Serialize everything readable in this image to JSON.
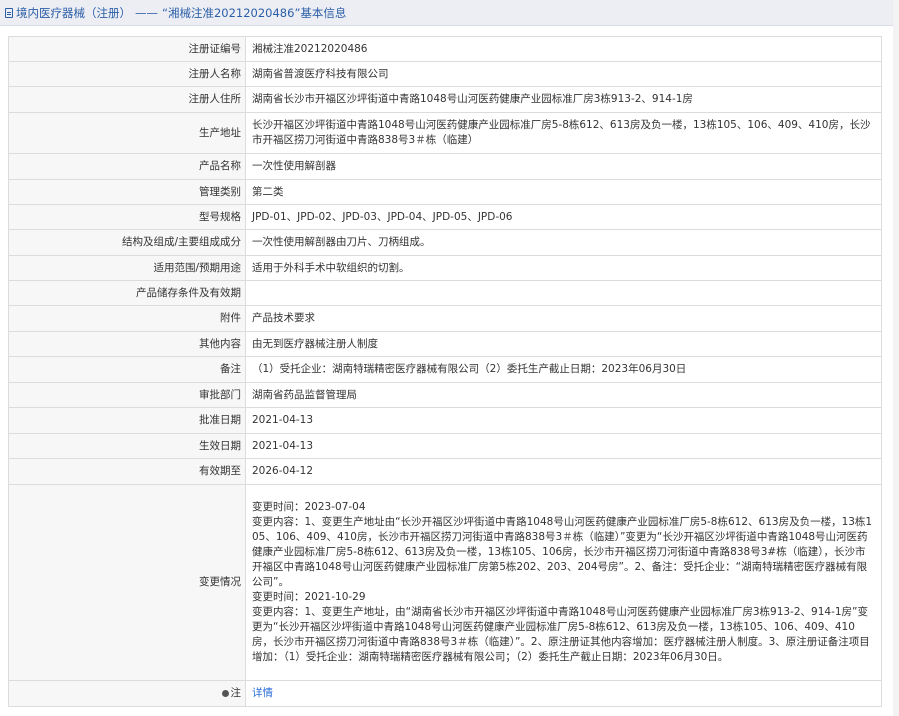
{
  "header": {
    "crumb": "境内医疗器械（注册）",
    "separator": "——",
    "title": "“湘械注准20212020486”基本信息"
  },
  "rows": [
    {
      "label": "注册证编号",
      "value": "湘械注准20212020486"
    },
    {
      "label": "注册人名称",
      "value": "湖南省普渡医疗科技有限公司"
    },
    {
      "label": "注册人住所",
      "value": "湖南省长沙市开福区沙坪街道中青路1048号山河医药健康产业园标准厂房3栋913-2、914-1房"
    },
    {
      "label": "生产地址",
      "value": "长沙开福区沙坪街道中青路1048号山河医药健康产业园标准厂房5-8栋612、613房及负一楼，13栋105、106、409、410房，长沙市开福区捞刀河街道中青路838号3＃栋（临建）"
    },
    {
      "label": "产品名称",
      "value": "一次性使用解剖器"
    },
    {
      "label": "管理类别",
      "value": "第二类"
    },
    {
      "label": "型号规格",
      "value": "JPD-01、JPD-02、JPD-03、JPD-04、JPD-05、JPD-06"
    },
    {
      "label": "结构及组成/主要组成成分",
      "value": "一次性使用解剖器由刀片、刀柄组成。"
    },
    {
      "label": "适用范围/预期用途",
      "value": "适用于外科手术中软组织的切割。"
    },
    {
      "label": "产品储存条件及有效期",
      "value": ""
    },
    {
      "label": "附件",
      "value": "产品技术要求"
    },
    {
      "label": "其他内容",
      "value": "由无到医疗器械注册人制度"
    },
    {
      "label": "备注",
      "value": "（1）受托企业：湖南特瑞精密医疗器械有限公司（2）委托生产截止日期：2023年06月30日"
    },
    {
      "label": "审批部门",
      "value": "湖南省药品监督管理局"
    },
    {
      "label": "批准日期",
      "value": "2021-04-13"
    },
    {
      "label": "生效日期",
      "value": "2021-04-13"
    },
    {
      "label": "有效期至",
      "value": "2026-04-12"
    }
  ],
  "changes": {
    "label": "变更情况",
    "lines": [
      "变更时间：2023-07-04",
      "变更内容：1、变更生产地址由“长沙开福区沙坪街道中青路1048号山河医药健康产业园标准厂房5-8栋612、613房及负一楼，13栋105、106、409、410房，长沙市开福区捞刀河街道中青路838号3＃栋（临建）”变更为“长沙开福区沙坪街道中青路1048号山河医药健康产业园标准厂房5-8栋612、613房及负一楼，13栋105、106房，长沙市开福区捞刀河街道中青路838号3#栋（临建），长沙市开福区中青路1048号山河医药健康产业园标准厂房第5栋202、203、204号房”。2、备注：受托企业：“湖南特瑞精密医疗器械有限公司”。",
      "变更时间：2021-10-29",
      "变更内容：1、变更生产地址，由“湖南省长沙市开福区沙坪街道中青路1048号山河医药健康产业园标准厂房3栋913-2、914-1房”变更为“长沙开福区沙坪街道中青路1048号山河医药健康产业园标准厂房5-8栋612、613房及负一楼，13栋105、106、409、410房，长沙市开福区捞刀河街道中青路838号3＃栋（临建）”。2、原注册证其他内容增加：医疗器械注册人制度。3、原注册证备注项目增加：（1）受托企业：湖南特瑞精密医疗器械有限公司；（2）委托生产截止日期：2023年06月30日。"
    ]
  },
  "note": {
    "label": "注",
    "link": "详情"
  },
  "colors": {
    "accent": "#2b5ea8",
    "link": "#2b6ed9",
    "label_bg": "#f7f7f7",
    "border": "#dcdcdc"
  }
}
